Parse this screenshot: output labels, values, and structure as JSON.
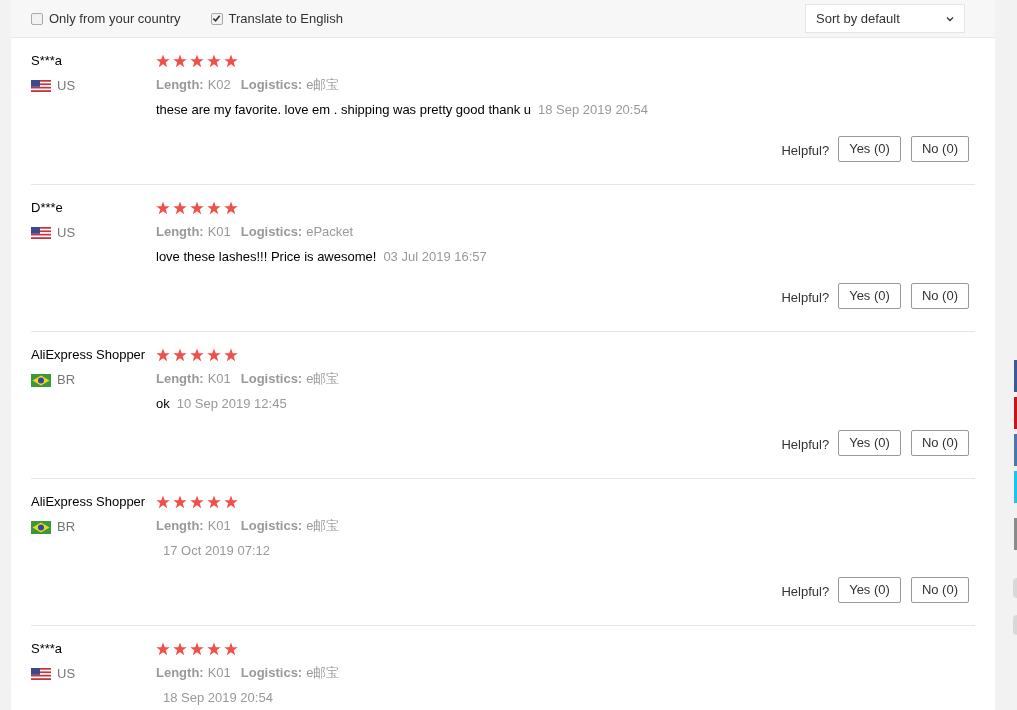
{
  "filters": [
    {
      "label": "Only from your country",
      "checked": false
    },
    {
      "label": "Translate to English",
      "checked": true
    }
  ],
  "sort": {
    "value": "Sort by default"
  },
  "reviews": [
    {
      "name": "S***a",
      "kind": "us_flag",
      "country": "US",
      "stars": 5,
      "attributes": [
        {
          "label": "Length:",
          "value": "K02"
        },
        {
          "label": "Logistics:",
          "value": "e邮宝"
        }
      ],
      "text": "these are my favorite. love em . shipping was pretty good thank u",
      "date": "18 Sep 2019 20:54",
      "helpful": "Helpful?",
      "yes": "Yes (0)",
      "no": "No (0)"
    },
    {
      "name": "D***e",
      "kind": "us_flag",
      "country": "US",
      "stars": 5,
      "attributes": [
        {
          "label": "Length:",
          "value": "K01"
        },
        {
          "label": "Logistics:",
          "value": "ePacket"
        }
      ],
      "text": "love these lashes!!! Price is awesome!",
      "date": "03 Jul 2019 16:57",
      "helpful": "Helpful?",
      "yes": "Yes (0)",
      "no": "No (0)"
    },
    {
      "name": "AliExpress Shopper",
      "kind": "br_flag",
      "country": "BR",
      "stars": 5,
      "attributes": [
        {
          "label": "Length:",
          "value": "K01"
        },
        {
          "label": "Logistics:",
          "value": "e邮宝"
        }
      ],
      "text": "ok",
      "date": "10 Sep 2019 12:45",
      "helpful": "Helpful?",
      "yes": "Yes (0)",
      "no": "No (0)"
    },
    {
      "name": "AliExpress Shopper",
      "kind": "br_flag",
      "country": "BR",
      "stars": 5,
      "attributes": [
        {
          "label": "Length:",
          "value": "K01"
        },
        {
          "label": "Logistics:",
          "value": "e邮宝"
        }
      ],
      "date": "17 Oct 2019 07:12",
      "helpful": "Helpful?",
      "yes": "Yes (0)",
      "no": "No (0)"
    },
    {
      "name": "S***a",
      "kind": "us_flag",
      "country": "US",
      "stars": 5,
      "attributes": [
        {
          "label": "Length:",
          "value": "K01"
        },
        {
          "label": "Logistics:",
          "value": "e邮宝"
        }
      ],
      "date": "18 Sep 2019 20:54"
    }
  ]
}
